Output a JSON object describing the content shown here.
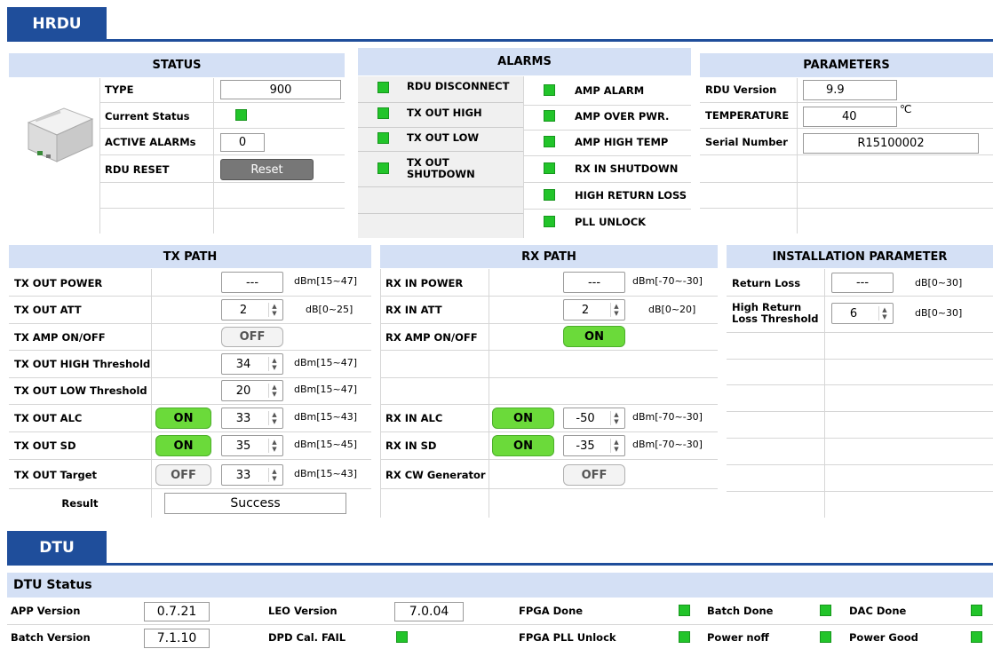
{
  "hrdu": {
    "tab": "HRDU"
  },
  "status": {
    "header": "STATUS",
    "type_label": "TYPE",
    "type_value": "900",
    "current_status_label": "Current Status",
    "active_alarms_label": "ACTIVE ALARMs",
    "active_alarms_value": "0",
    "rdu_reset_label": "RDU RESET",
    "reset_button": "Reset"
  },
  "alarms": {
    "header": "ALARMS",
    "left": [
      "RDU DISCONNECT",
      "TX OUT HIGH",
      "TX OUT LOW",
      "TX OUT SHUTDOWN"
    ],
    "right": [
      "AMP ALARM",
      "AMP OVER PWR.",
      "AMP HIGH TEMP",
      "RX IN SHUTDOWN",
      "HIGH RETURN LOSS",
      "PLL UNLOCK"
    ]
  },
  "parameters": {
    "header": "PARAMETERS",
    "rdu_version_label": "RDU Version",
    "rdu_version": "9.9",
    "temperature_label": "TEMPERATURE",
    "temperature": "40",
    "temperature_unit": "℃",
    "serial_label": "Serial Number",
    "serial": "R15100002"
  },
  "tx": {
    "header": "TX PATH",
    "out_power_label": "TX OUT POWER",
    "out_power_value": "---",
    "out_power_unit": "dBm[15~47]",
    "out_att_label": "TX OUT ATT",
    "out_att_value": "2",
    "out_att_unit": "dB[0~25]",
    "amp_label": "TX AMP ON/OFF",
    "amp_state": "OFF",
    "high_th_label": "TX OUT HIGH Threshold",
    "high_th_value": "34",
    "high_th_unit": "dBm[15~47]",
    "low_th_label": "TX OUT LOW Threshold",
    "low_th_value": "20",
    "low_th_unit": "dBm[15~47]",
    "alc_label": "TX OUT ALC",
    "alc_state": "ON",
    "alc_value": "33",
    "alc_unit": "dBm[15~43]",
    "sd_label": "TX OUT SD",
    "sd_state": "ON",
    "sd_value": "35",
    "sd_unit": "dBm[15~45]",
    "target_label": "TX OUT Target",
    "target_state": "OFF",
    "target_value": "33",
    "target_unit": "dBm[15~43]",
    "result_label": "Result",
    "result_value": "Success"
  },
  "rx": {
    "header": "RX PATH",
    "in_power_label": "RX IN POWER",
    "in_power_value": "---",
    "in_power_unit": "dBm[-70~-30]",
    "in_att_label": "RX IN ATT",
    "in_att_value": "2",
    "in_att_unit": "dB[0~20]",
    "amp_label": "RX AMP ON/OFF",
    "amp_state": "ON",
    "alc_label": "RX IN ALC",
    "alc_state": "ON",
    "alc_value": "-50",
    "alc_unit": "dBm[-70~-30]",
    "sd_label": "RX IN SD",
    "sd_state": "ON",
    "sd_value": "-35",
    "sd_unit": "dBm[-70~-30]",
    "cw_label": "RX CW Generator",
    "cw_state": "OFF"
  },
  "install": {
    "header": "INSTALLATION PARAMETER",
    "return_loss_label": "Return Loss",
    "return_loss_value": "---",
    "return_loss_unit": "dB[0~30]",
    "hrl_label": "High Return Loss Threshold",
    "hrl_value": "6",
    "hrl_unit": "dB[0~30]"
  },
  "dtu": {
    "tab": "DTU",
    "status_header": "DTU Status",
    "app_version_label": "APP Version",
    "app_version": "0.7.21",
    "batch_version_label": "Batch Version",
    "batch_version": "7.1.10",
    "leo_version_label": "LEO Version",
    "leo_version": "7.0.04",
    "dpd_label": "DPD Cal. FAIL",
    "fpga_done_label": "FPGA Done",
    "fpga_pll_label": "FPGA PLL Unlock",
    "batch_done_label": "Batch Done",
    "power_noff_label": "Power noff",
    "dac_done_label": "DAC Done",
    "power_good_label": "Power Good"
  },
  "colors": {
    "accent": "#1f4e9b",
    "header_bg": "#d4e0f5",
    "led_green": "#22c42a",
    "on_green": "#6bda3a"
  }
}
